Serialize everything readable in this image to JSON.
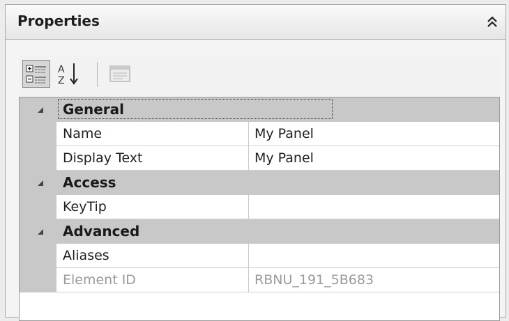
{
  "panel": {
    "title": "Properties",
    "collapse_icon": "double-chevron-up-icon"
  },
  "toolbar": {
    "buttons": [
      {
        "name": "categorized-view",
        "icon": "categorized-icon",
        "pressed": true
      },
      {
        "name": "alphabetical-sort",
        "icon": "sort-az-icon",
        "pressed": false
      },
      {
        "name": "property-pages",
        "icon": "property-pages-icon",
        "enabled": false
      }
    ]
  },
  "grid": {
    "categories": [
      {
        "label": "General",
        "properties": [
          {
            "name": "Name",
            "value": "My Panel"
          },
          {
            "name": "Display Text",
            "value": "My Panel"
          }
        ]
      },
      {
        "label": "Access",
        "properties": [
          {
            "name": "KeyTip",
            "value": ""
          }
        ]
      },
      {
        "label": "Advanced",
        "properties": [
          {
            "name": "Aliases",
            "value": ""
          },
          {
            "name": "Element ID",
            "value": "RBNU_191_5B683",
            "readonly": true
          }
        ]
      }
    ]
  }
}
